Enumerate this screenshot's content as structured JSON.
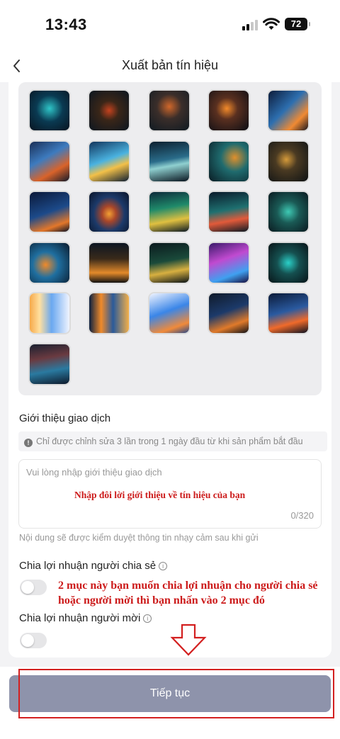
{
  "status_bar": {
    "time": "13:43",
    "battery": "72"
  },
  "nav": {
    "title": "Xuất bản tín hiệu"
  },
  "images": [
    {
      "name": "thumb-1",
      "bg": "radial-gradient(circle at 50% 45%, #2ec5c8 0%, #0a3a52 45%, #081420 100%)"
    },
    {
      "name": "thumb-2",
      "bg": "radial-gradient(circle at 50% 50%, #c4421e 0%, #3a2618 35%, #0c1620 100%)"
    },
    {
      "name": "thumb-3",
      "bg": "radial-gradient(circle at 50% 40%, #d0672a 0%, #3b2e2a 40%, #0f1a22 100%)"
    },
    {
      "name": "thumb-4",
      "bg": "radial-gradient(circle at 45% 45%, #f38a2a 0%, #5a3020 35%, #0b0d14 100%)"
    },
    {
      "name": "thumb-5",
      "bg": "linear-gradient(135deg, #0d1c3a 0%, #2d6fb0 45%, #f08a33 75%, #1a1820 100%)"
    },
    {
      "name": "thumb-6",
      "bg": "linear-gradient(150deg, #1a2f55 0%, #3d7bbf 40%, #d9632a 70%, #121a2a 100%)"
    },
    {
      "name": "thumb-7",
      "bg": "linear-gradient(160deg, #12355c 0%, #4ab2e0 45%, #f3c048 65%, #0e1f33 100%)"
    },
    {
      "name": "thumb-8",
      "bg": "linear-gradient(170deg, #0c1f2e 0%, #2a6c8a 45%, #8fd0d0 60%, #0a1620 100%)"
    },
    {
      "name": "thumb-9",
      "bg": "radial-gradient(circle at 65% 40%, #e0902c 0%, #1f6b6e 40%, #0a1c24 100%)"
    },
    {
      "name": "thumb-10",
      "bg": "radial-gradient(circle at 45% 45%, #d59a3a 0%, #4a3a22 35%, #0e1214 100%)"
    },
    {
      "name": "thumb-11",
      "bg": "linear-gradient(160deg, #0b1838 0%, #1c4a8a 50%, #e3772a 80%, #0b1226 100%)"
    },
    {
      "name": "thumb-12",
      "bg": "radial-gradient(ellipse at 50% 55%, #f3a033 0%, #a8462a 25%, #1c3a6a 55%, #0a1428 100%)"
    },
    {
      "name": "thumb-13",
      "bg": "linear-gradient(170deg, #0d2a3a 0%, #1f8a6a 40%, #e0c040 70%, #0c1a24 100%)"
    },
    {
      "name": "thumb-14",
      "bg": "linear-gradient(170deg, #0a1a2a 0%, #1e7070 45%, #e25a3a 70%, #0c1a24 100%)"
    },
    {
      "name": "thumb-15",
      "bg": "radial-gradient(circle at 50% 50%, #3ec9b4 0%, #1a5a55 40%, #0a1a20 100%)"
    },
    {
      "name": "thumb-16",
      "bg": "radial-gradient(circle at 40% 55%, #f08a2a 0%, #1f6fa0 40%, #0a1a2c 100%)"
    },
    {
      "name": "thumb-17",
      "bg": "linear-gradient(180deg, #0c1622 0%, #3a2a1a 40%, #e38a2a 75%, #121212 100%)"
    },
    {
      "name": "thumb-18",
      "bg": "linear-gradient(170deg, #0b1a1e 0%, #1a4a3a 45%, #d8b040 70%, #0b1418 100%)"
    },
    {
      "name": "thumb-19",
      "bg": "linear-gradient(160deg, #3a1a6a 0%, #c04ad0 40%, #3fa0f0 75%, #1a1040 100%)"
    },
    {
      "name": "thumb-20",
      "bg": "radial-gradient(circle at 50% 50%, #2ad0c8 0%, #155050 40%, #081418 100%)"
    },
    {
      "name": "thumb-21",
      "bg": "linear-gradient(90deg, #f6a94a 0%, #ffe0a0 25%, #6aa8f0 55%, #f0f4ff 100%)"
    },
    {
      "name": "thumb-22",
      "bg": "linear-gradient(90deg, #0c2040 0%, #f08a2a 30%, #2a5a9a 60%, #f3b04a 100%)"
    },
    {
      "name": "thumb-23",
      "bg": "linear-gradient(160deg, #f0f4ff 0%, #3a86e8 45%, #f08a3a 80%, #2a4a8a 100%)"
    },
    {
      "name": "thumb-24",
      "bg": "linear-gradient(160deg, #101a2a 0%, #1c3a6a 45%, #e07a2a 75%, #101218 100%)"
    },
    {
      "name": "thumb-25",
      "bg": "linear-gradient(165deg, #0b1a38 0%, #2a5aa0 45%, #f06a2a 72%, #0c1222 100%)"
    },
    {
      "name": "thumb-26",
      "bg": "linear-gradient(170deg, #1a2030 0%, #6a3a40 35%, #2a7aa0 65%, #0e1a2c 100%)"
    }
  ],
  "intro": {
    "label": "Giới thiệu giao dịch",
    "notice": "Chỉ được chỉnh sửa 3 lần trong 1 ngày đầu từ khi sản phẩm bắt đầu",
    "notice_icon": "!",
    "placeholder": "Vui lòng nhập giới thiệu giao dịch",
    "counter": "0/320",
    "review_note": "Nội dung sẽ được kiểm duyệt thông tin nhạy cảm sau khi gửi"
  },
  "profit_share": {
    "sharer_label": "Chia lợi nhuận người chia sẻ",
    "inviter_label": "Chia lợi nhuận người mời",
    "info_icon": "i",
    "sharer_enabled": false,
    "inviter_enabled": false
  },
  "annotations": {
    "intro_hint": "Nhập đôi lời giới thiệu về tín hiệu của bạn",
    "toggle_hint": "2 mục này bạn muốn chia lợi nhuận cho người chia sẻ hoặc người mời thì bạn nhấn vào 2 mục đó",
    "highlight_color": "#d32020"
  },
  "footer": {
    "continue_label": "Tiếp tục",
    "button_color": "#8e93ab"
  }
}
